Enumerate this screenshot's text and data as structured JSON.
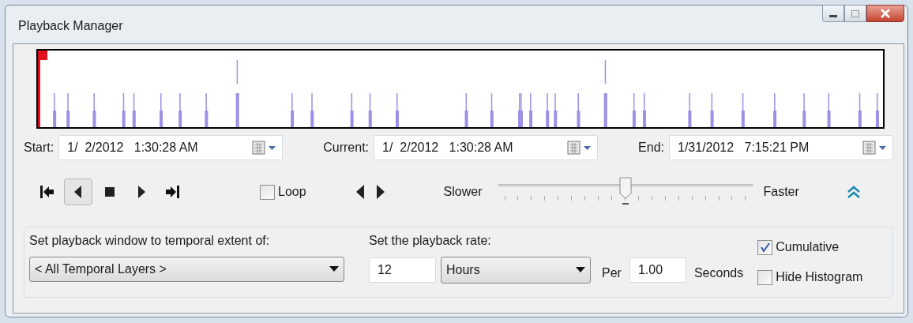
{
  "window": {
    "title": "Playback Manager"
  },
  "time_fields": [
    {
      "label": "Start:",
      "value": "1/  2/2012   1:30:28 AM"
    },
    {
      "label": "Current:",
      "value": "1/  2/2012   1:30:28 AM"
    },
    {
      "label": "End:",
      "value": "1/31/2012   7:15:21 PM"
    }
  ],
  "transport_buttons": [
    {
      "kind": "first",
      "selected": false
    },
    {
      "kind": "reverse",
      "selected": true
    },
    {
      "kind": "stop",
      "selected": false
    },
    {
      "kind": "play",
      "selected": false
    },
    {
      "kind": "last",
      "selected": false
    }
  ],
  "loop": {
    "label": "Loop",
    "checked": false
  },
  "speed": {
    "min_label": "Slower",
    "max_label": "Faster",
    "level": 0.5
  },
  "extent": {
    "label": "Set playback window to temporal extent of:",
    "value": "< All Temporal Layers >"
  },
  "rate": {
    "label": "Set the playback rate:",
    "amount": "12",
    "unit": "Hours",
    "per_label": "Per",
    "per_value": "1.00",
    "seconds_label": "Seconds"
  },
  "options": [
    {
      "label": "Cumulative",
      "checked": true
    },
    {
      "label": "Hide Histogram",
      "checked": false
    }
  ]
}
